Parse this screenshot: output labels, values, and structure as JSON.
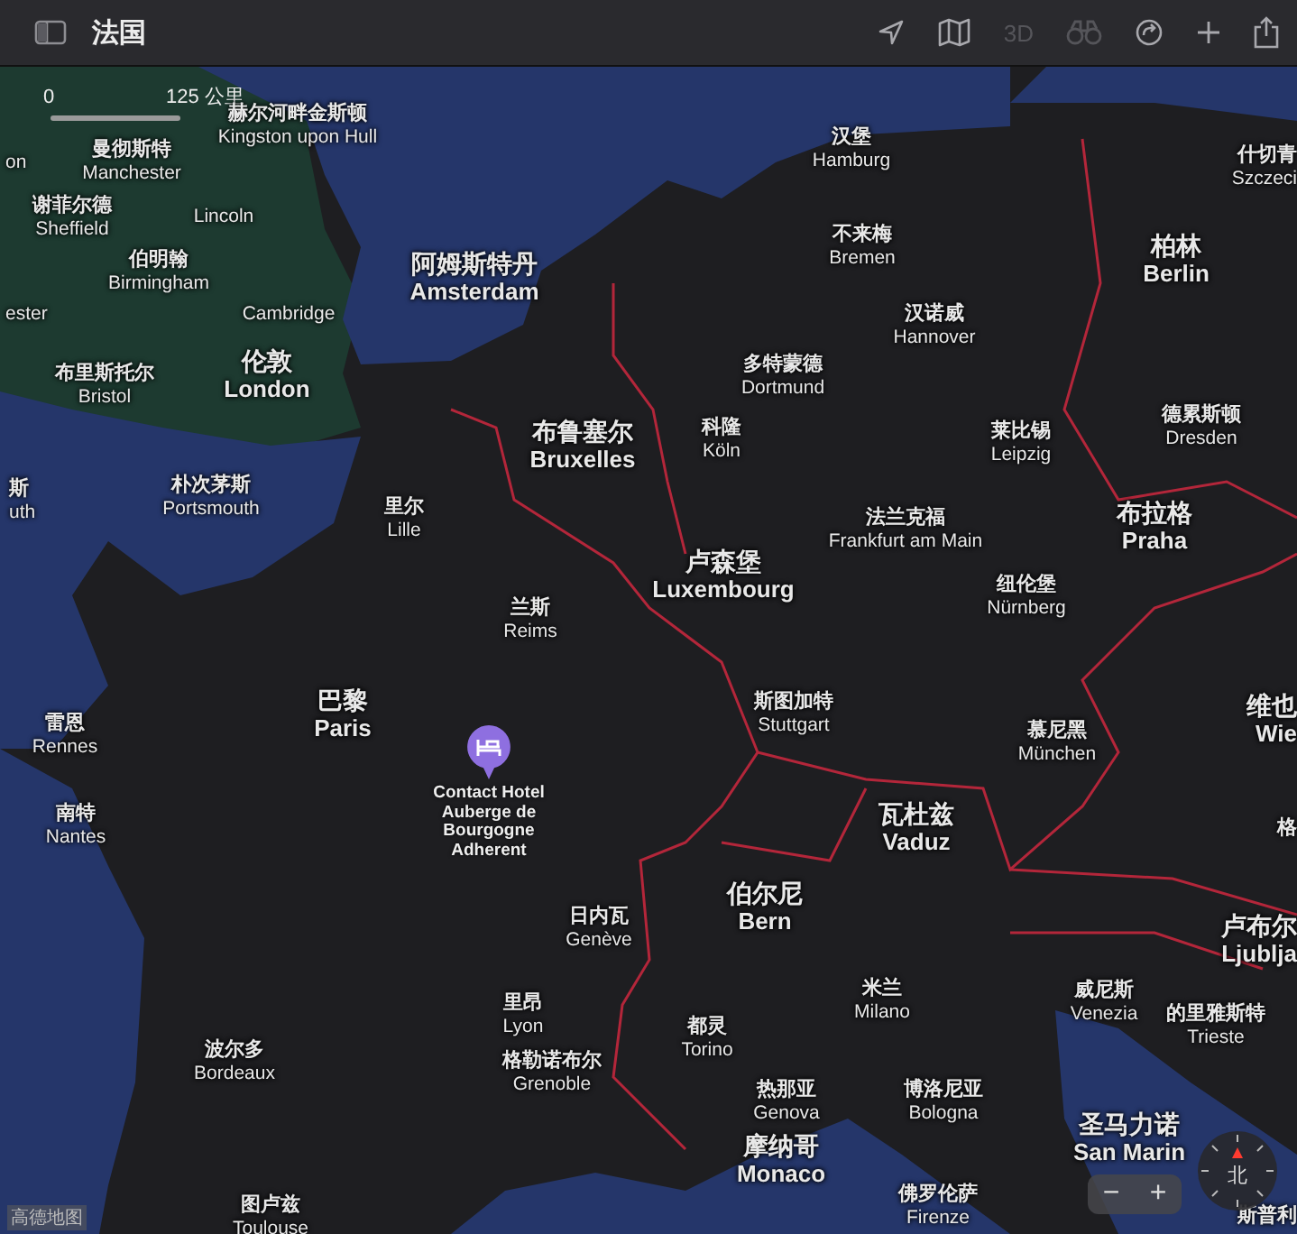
{
  "toolbar": {
    "title": "法国",
    "three_d": {
      "label": "3D",
      "disabled": true
    },
    "look_around": {
      "disabled": true
    }
  },
  "scale": {
    "start": "0",
    "end": "125 公里"
  },
  "labels": [
    {
      "cn": "赫尔河畔金斯顿",
      "en": "Kingston upon Hull",
      "kind": "minor"
    },
    {
      "en": "on",
      "kind": "minor"
    },
    {
      "cn": "曼彻斯特",
      "en": "Manchester",
      "kind": "minor"
    },
    {
      "cn": "谢菲尔德",
      "en": "Sheffield",
      "kind": "minor"
    },
    {
      "en": "Lincoln",
      "kind": "minor"
    },
    {
      "cn": "伯明翰",
      "en": "Birmingham",
      "kind": "minor"
    },
    {
      "en": "ester",
      "kind": "minor"
    },
    {
      "en": "Cambridge",
      "kind": "minor"
    },
    {
      "cn": "布里斯托尔",
      "en": "Bristol",
      "kind": "minor"
    },
    {
      "cn": "伦敦",
      "en": "London",
      "kind": "major"
    },
    {
      "cn": "阿姆斯特丹",
      "en": "Amsterdam",
      "kind": "major"
    },
    {
      "cn": "汉堡",
      "en": "Hamburg",
      "kind": "minor"
    },
    {
      "cn": "什切青",
      "en": "Szczeci",
      "kind": "minor"
    },
    {
      "cn": "不来梅",
      "en": "Bremen",
      "kind": "minor"
    },
    {
      "cn": "柏林",
      "en": "Berlin",
      "kind": "major"
    },
    {
      "cn": "汉诺威",
      "en": "Hannover",
      "kind": "minor"
    },
    {
      "cn": "多特蒙德",
      "en": "Dortmund",
      "kind": "minor"
    },
    {
      "cn": "布鲁塞尔",
      "en": "Bruxelles",
      "kind": "major"
    },
    {
      "cn": "科隆",
      "en": "Köln",
      "kind": "minor"
    },
    {
      "cn": "莱比锡",
      "en": "Leipzig",
      "kind": "minor"
    },
    {
      "cn": "德累斯顿",
      "en": "Dresden",
      "kind": "minor"
    },
    {
      "cn": "斯",
      "en": "uth",
      "kind": "minor"
    },
    {
      "cn": "朴次茅斯",
      "en": "Portsmouth",
      "kind": "minor"
    },
    {
      "cn": "里尔",
      "en": "Lille",
      "kind": "minor"
    },
    {
      "cn": "法兰克福",
      "en": "Frankfurt am Main",
      "kind": "minor"
    },
    {
      "cn": "布拉格",
      "en": "Praha",
      "kind": "major"
    },
    {
      "cn": "卢森堡",
      "en": "Luxembourg",
      "kind": "major"
    },
    {
      "cn": "纽伦堡",
      "en": "Nürnberg",
      "kind": "minor"
    },
    {
      "cn": "兰斯",
      "en": "Reims",
      "kind": "minor"
    },
    {
      "cn": "雷恩",
      "en": "Rennes",
      "kind": "minor"
    },
    {
      "cn": "巴黎",
      "en": "Paris",
      "kind": "major"
    },
    {
      "cn": "斯图加特",
      "en": "Stuttgart",
      "kind": "minor"
    },
    {
      "cn": "慕尼黑",
      "en": "München",
      "kind": "minor"
    },
    {
      "cn": "维也",
      "en": "Wie",
      "kind": "major"
    },
    {
      "cn": "南特",
      "en": "Nantes",
      "kind": "minor"
    },
    {
      "cn": "瓦杜兹",
      "en": "Vaduz",
      "kind": "major"
    },
    {
      "cn": "格",
      "kind": "minor"
    },
    {
      "cn": "日内瓦",
      "en": "Genève",
      "kind": "minor"
    },
    {
      "cn": "伯尔尼",
      "en": "Bern",
      "kind": "major"
    },
    {
      "cn": "卢布尔",
      "en": "Ljublja",
      "kind": "major"
    },
    {
      "cn": "里昂",
      "en": "Lyon",
      "kind": "minor"
    },
    {
      "cn": "都灵",
      "en": "Torino",
      "kind": "minor"
    },
    {
      "cn": "米兰",
      "en": "Milano",
      "kind": "minor"
    },
    {
      "cn": "威尼斯",
      "en": "Venezia",
      "kind": "minor"
    },
    {
      "cn": "的里雅斯特",
      "en": "Trieste",
      "kind": "minor"
    },
    {
      "cn": "波尔多",
      "en": "Bordeaux",
      "kind": "minor"
    },
    {
      "cn": "格勒诺布尔",
      "en": "Grenoble",
      "kind": "minor"
    },
    {
      "cn": "热那亚",
      "en": "Genova",
      "kind": "minor"
    },
    {
      "cn": "博洛尼亚",
      "en": "Bologna",
      "kind": "minor"
    },
    {
      "cn": "摩纳哥",
      "en": "Monaco",
      "kind": "major"
    },
    {
      "cn": "圣马力诺",
      "en": "San Marin",
      "kind": "major"
    },
    {
      "cn": "图卢兹",
      "en": "Toulouse",
      "kind": "minor"
    },
    {
      "cn": "佛罗伦萨",
      "en": "Firenze",
      "kind": "minor"
    },
    {
      "cn": "斯普利",
      "kind": "minor"
    }
  ],
  "hotel": {
    "name": "Contact Hotel Auberge de Bourgogne Adherent"
  },
  "zoom": {
    "minus": "−",
    "plus": "+"
  },
  "compass": {
    "label": "北"
  },
  "attribution": "高德地图"
}
